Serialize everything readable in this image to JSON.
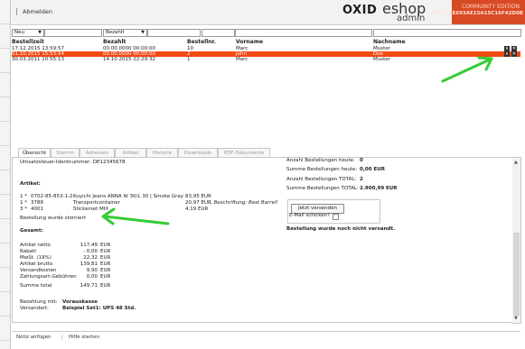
{
  "header": {
    "logout": "Abmelden",
    "logo_oxid": "OXID",
    "logo_eshop": "eshop",
    "logo_admin": "admin",
    "edition_line1": "COMMUNITY EDITION",
    "edition_line2": "4.9.5_EE693AE15A15C16F42D0B"
  },
  "filters": {
    "status_select": "Neu",
    "paid_select": "Bezahlt"
  },
  "columns": {
    "date": "Bestellzeit",
    "paid": "Bezahlt",
    "orderno": "Bestellnr.",
    "firstname": "Vorname",
    "lastname": "Nachname"
  },
  "orders": [
    {
      "date": "17.12.2015 13:59:57",
      "paid": "00.00.0000 00:00:00",
      "no": "10",
      "first": "Marc",
      "last": "Muster"
    },
    {
      "date": "01.10.2015 15:53:54",
      "paid": "00.00.0000 00:00:00",
      "no": "2",
      "first": "John",
      "last": "Doe"
    },
    {
      "date": "30.03.2011 10:55:13",
      "paid": "14.10.2015 22:29:32",
      "no": "1",
      "first": "Marc",
      "last": "Muster"
    }
  ],
  "tabs": [
    "Übersicht",
    "Stamm",
    "Adressen",
    "Artikel",
    "Historie",
    "Downloads",
    "PDF-Dokumente"
  ],
  "details": {
    "vat_id": "Umsatzsteuer-Identnummer: DE12345678",
    "articles_title": "Artikel:",
    "items": [
      {
        "qty": "1 *",
        "artnr": "0702-85-853-1-2",
        "title": "Kuyichi Jeans ANNA  W 30/L 30 | Smoke Gray",
        "price": "83,95 EUR",
        "extra": ""
      },
      {
        "qty": "1 *",
        "artnr": "3788",
        "title": "Transportcontainer",
        "price": "20,97 EUR",
        "extra": ", Beschriftung: Best Barrel!"
      },
      {
        "qty": "3 *",
        "artnr": "4001",
        "title": "Stickerset MIX",
        "price": "4,19 EUR",
        "extra": ""
      }
    ],
    "cancelled": "Bestellung wurde storniert",
    "total_title": "Gesamt:",
    "sums": [
      {
        "label": "Artikel netto",
        "value": "117,49",
        "cur": "EUR"
      },
      {
        "label": "Rabatt",
        "value": "- 0,00",
        "cur": "EUR"
      },
      {
        "label": "MwSt. (19%)",
        "value": "22,32",
        "cur": "EUR"
      },
      {
        "label": "Artikel brutto",
        "value": "139,81",
        "cur": "EUR"
      },
      {
        "label": "Versandkosten",
        "value": "9,90",
        "cur": "EUR"
      },
      {
        "label": "Zahlungsart-Gebühren",
        "value": "0,00",
        "cur": "EUR"
      }
    ],
    "grand_total": {
      "label": "Summe total",
      "value": "149,71",
      "cur": "EUR"
    },
    "payment_label": "Bezahlung mit:",
    "payment_value": "Vorauskasse",
    "shipping_label": "Versandart:",
    "shipping_value": "Beispiel Set1: UPS 48 Std.",
    "stats": [
      {
        "label": "Anzahl Bestellungen heute:",
        "value": "0"
      },
      {
        "label": "Summe Bestellungen heute:",
        "value": "0,00 EUR"
      },
      {
        "label": "Anzahl Bestellungen TOTAL:",
        "value": "2"
      },
      {
        "label": "Summe Bestellungen TOTAL:",
        "value": "2.900,99 EUR"
      }
    ],
    "send_button": "Jetzt versenden",
    "email_label": "E-Mail schicken?",
    "not_shipped": "Bestellung wurde noch nicht versandt."
  },
  "footer": {
    "add_note": "Notiz anfügen",
    "help": "Hilfe starten"
  },
  "colors": {
    "selected_row": "#f14a14",
    "edition_bg": "#d84a24",
    "arrow": "#33cc33"
  }
}
